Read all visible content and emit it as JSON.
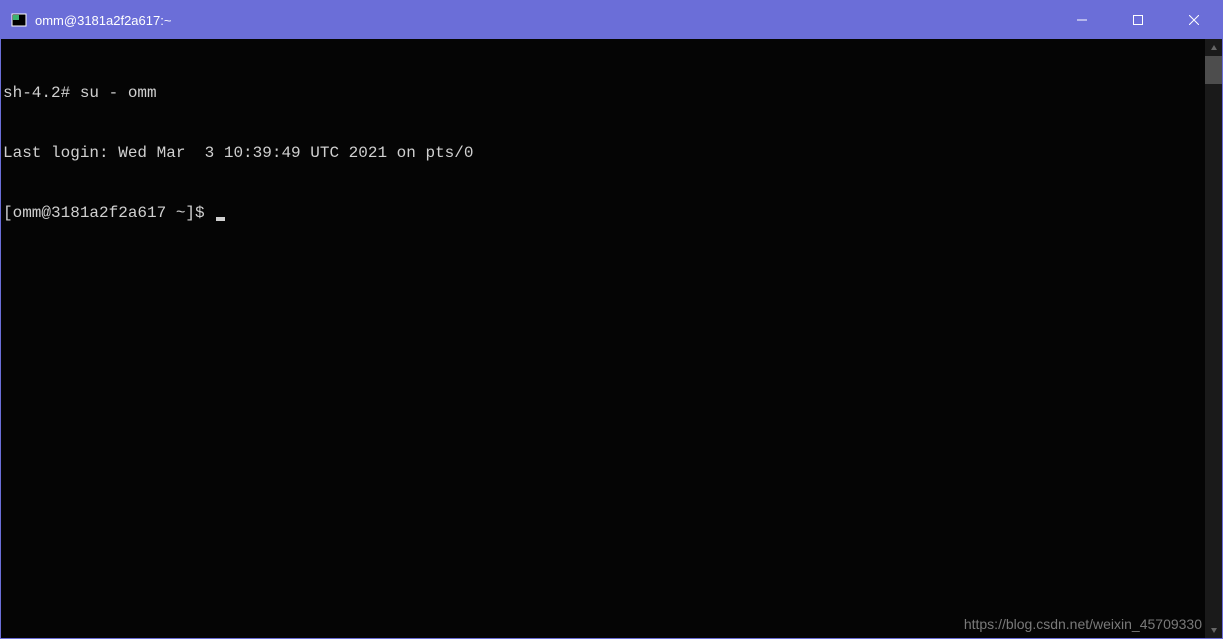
{
  "titlebar": {
    "title": "omm@3181a2f2a617:~"
  },
  "terminal": {
    "lines": [
      "sh-4.2# su - omm",
      "Last login: Wed Mar  3 10:39:49 UTC 2021 on pts/0",
      "[omm@3181a2f2a617 ~]$ "
    ]
  },
  "watermark": "https://blog.csdn.net/weixin_45709330"
}
